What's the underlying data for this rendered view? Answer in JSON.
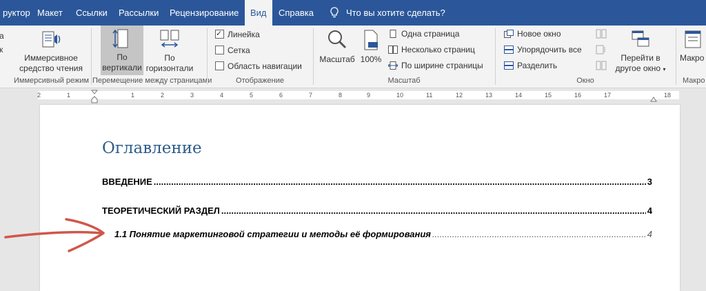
{
  "tabs": [
    "руктор",
    "Макет",
    "Ссылки",
    "Рассылки",
    "Рецензирование",
    "Вид",
    "Справка"
  ],
  "tell_me": "Что вы хотите сделать?",
  "ribbon": {
    "left_partial": [
      "а",
      "к"
    ],
    "immersive": {
      "btn_line1": "Иммерсивное",
      "btn_line2": "средство чтения",
      "group": "Иммерсивный режим"
    },
    "page_move": {
      "vertical_line1": "По",
      "vertical_line2": "вертикали",
      "horizontal_line1": "По",
      "horizontal_line2": "горизонтали",
      "group": "Перемещение между страницами"
    },
    "show": {
      "ruler": "Линейка",
      "grid": "Сетка",
      "nav": "Область навигации",
      "group": "Отображение",
      "ruler_checked": true,
      "grid_checked": false,
      "nav_checked": false
    },
    "zoom": {
      "zoom": "Масштаб",
      "percent": "100%",
      "one_page": "Одна страница",
      "multi_page": "Несколько страниц",
      "page_width": "По ширине страницы",
      "group": "Масштаб"
    },
    "window": {
      "new": "Новое окно",
      "arrange": "Упорядочить все",
      "split": "Разделить",
      "switch_line1": "Перейти в",
      "switch_line2": "другое окно",
      "group": "Окно"
    },
    "macros": {
      "label": "Макро",
      "group": "Макро"
    }
  },
  "ruler": [
    "2",
    "1",
    "1",
    "2",
    "3",
    "4",
    "5",
    "6",
    "7",
    "8",
    "9",
    "10",
    "11",
    "12",
    "13",
    "14",
    "15",
    "16",
    "17",
    "18"
  ],
  "document": {
    "title": "Оглавление",
    "entries": [
      {
        "text": "ВВЕДЕНИЕ",
        "page": "3"
      },
      {
        "text": "ТЕОРЕТИЧЕСКИЙ РАЗДЕЛ",
        "page": "4"
      },
      {
        "text": "1.1 Понятие маркетинговой стратегии и методы её формирования",
        "page": "4"
      }
    ]
  },
  "colors": {
    "ribbon_tab": "#2b579a",
    "heading": "#2e5c8a",
    "annotation_arrow": "#d0574a"
  }
}
